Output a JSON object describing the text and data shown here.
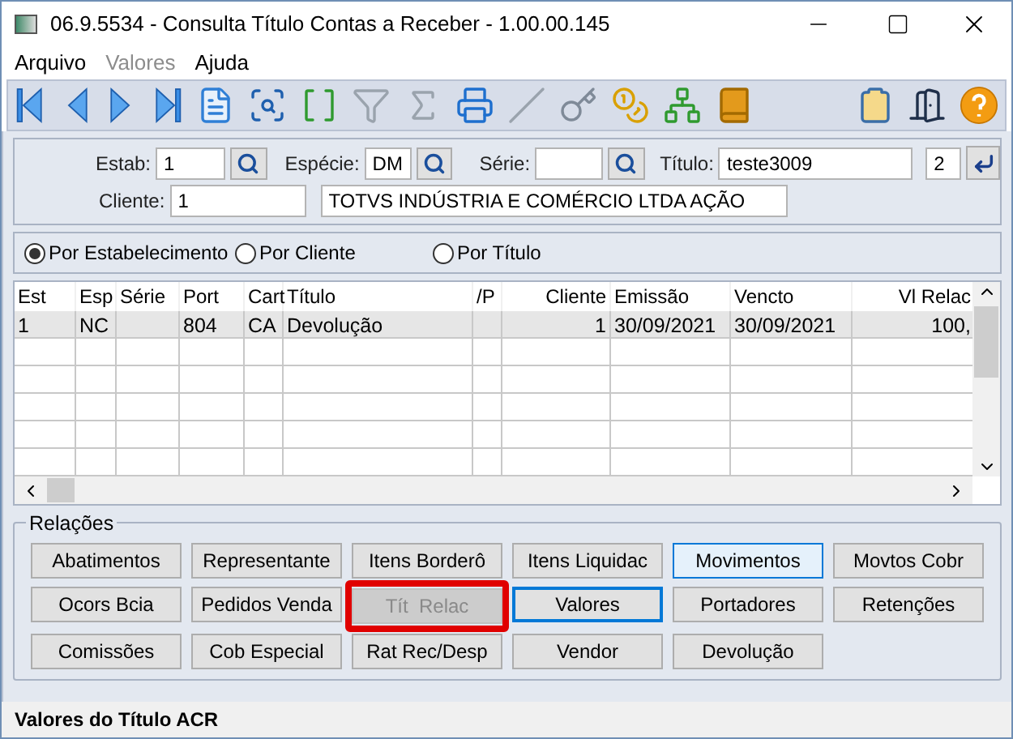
{
  "window": {
    "title": "06.9.5534 - Consulta Título Contas a Receber - 1.00.00.145"
  },
  "menu": [
    {
      "label": "Arquivo",
      "disabled": false
    },
    {
      "label": "Valores",
      "disabled": true
    },
    {
      "label": "Ajuda",
      "disabled": false
    }
  ],
  "filters": {
    "estab": {
      "label": "Estab:",
      "value": "1"
    },
    "especie": {
      "label": "Espécie:",
      "value": "DM"
    },
    "serie": {
      "label": "Série:"
    },
    "titulo": {
      "label": "Título:",
      "value": "teste3009"
    },
    "parcela": {
      "value": "2"
    },
    "cliente": {
      "label": "Cliente:",
      "value": "1"
    },
    "cliente_nome": {
      "value": "TOTVS INDÚSTRIA E COMÉRCIO LTDA AÇÃO"
    }
  },
  "order": [
    {
      "label": "Por Estabelecimento",
      "selected": true
    },
    {
      "label": "Por Cliente",
      "selected": false
    },
    {
      "label": "Por Título",
      "selected": false
    }
  ],
  "table": {
    "columns": [
      "Est",
      "Esp",
      "Série",
      "Port",
      "Cart",
      "Título",
      "/P",
      "Cliente",
      "Emissão",
      "Vencto",
      "Vl Relac"
    ],
    "rows": [
      {
        "cells": [
          "1",
          "NC",
          "",
          "804",
          "CA",
          "Devolução",
          "",
          "1",
          "30/09/2021",
          "30/09/2021",
          "100,"
        ],
        "selected": true
      }
    ]
  },
  "relations": {
    "title": "Relações",
    "buttons": [
      {
        "label": "Abatimentos",
        "disabled": false,
        "focused": false,
        "hovered": false,
        "marked": false
      },
      {
        "label": "Representante",
        "disabled": false,
        "focused": false,
        "hovered": false,
        "marked": false
      },
      {
        "label": "Itens Borderô",
        "disabled": false,
        "focused": false,
        "hovered": false,
        "marked": false
      },
      {
        "label": "Itens Liquidac",
        "disabled": false,
        "focused": false,
        "hovered": false,
        "marked": false
      },
      {
        "label": "Movimentos",
        "disabled": false,
        "focused": false,
        "hovered": true,
        "marked": false
      },
      {
        "label": "Movtos Cobr",
        "disabled": false,
        "focused": false,
        "hovered": false,
        "marked": false
      },
      {
        "label": "Ocors Bcia",
        "disabled": false,
        "focused": false,
        "hovered": false,
        "marked": false
      },
      {
        "label": "Pedidos Venda",
        "disabled": false,
        "focused": false,
        "hovered": false,
        "marked": false
      },
      {
        "label": "Tít  Relac",
        "disabled": true,
        "focused": false,
        "hovered": false,
        "marked": true
      },
      {
        "label": "Valores",
        "disabled": false,
        "focused": true,
        "hovered": false,
        "marked": false
      },
      {
        "label": "Portadores",
        "disabled": false,
        "focused": false,
        "hovered": false,
        "marked": false
      },
      {
        "label": "Retenções",
        "disabled": false,
        "focused": false,
        "hovered": false,
        "marked": false
      },
      {
        "label": "Comissões",
        "disabled": false,
        "focused": false,
        "hovered": false,
        "marked": false
      },
      {
        "label": "Cob Especial",
        "disabled": false,
        "focused": false,
        "hovered": false,
        "marked": false
      },
      {
        "label": "Rat Rec/Desp",
        "disabled": false,
        "focused": false,
        "hovered": false,
        "marked": false
      },
      {
        "label": "Vendor",
        "disabled": false,
        "focused": false,
        "hovered": false,
        "marked": false
      },
      {
        "label": "Devolução",
        "disabled": false,
        "focused": false,
        "hovered": false,
        "marked": false
      }
    ]
  },
  "status_bar": "Valores do Título ACR"
}
